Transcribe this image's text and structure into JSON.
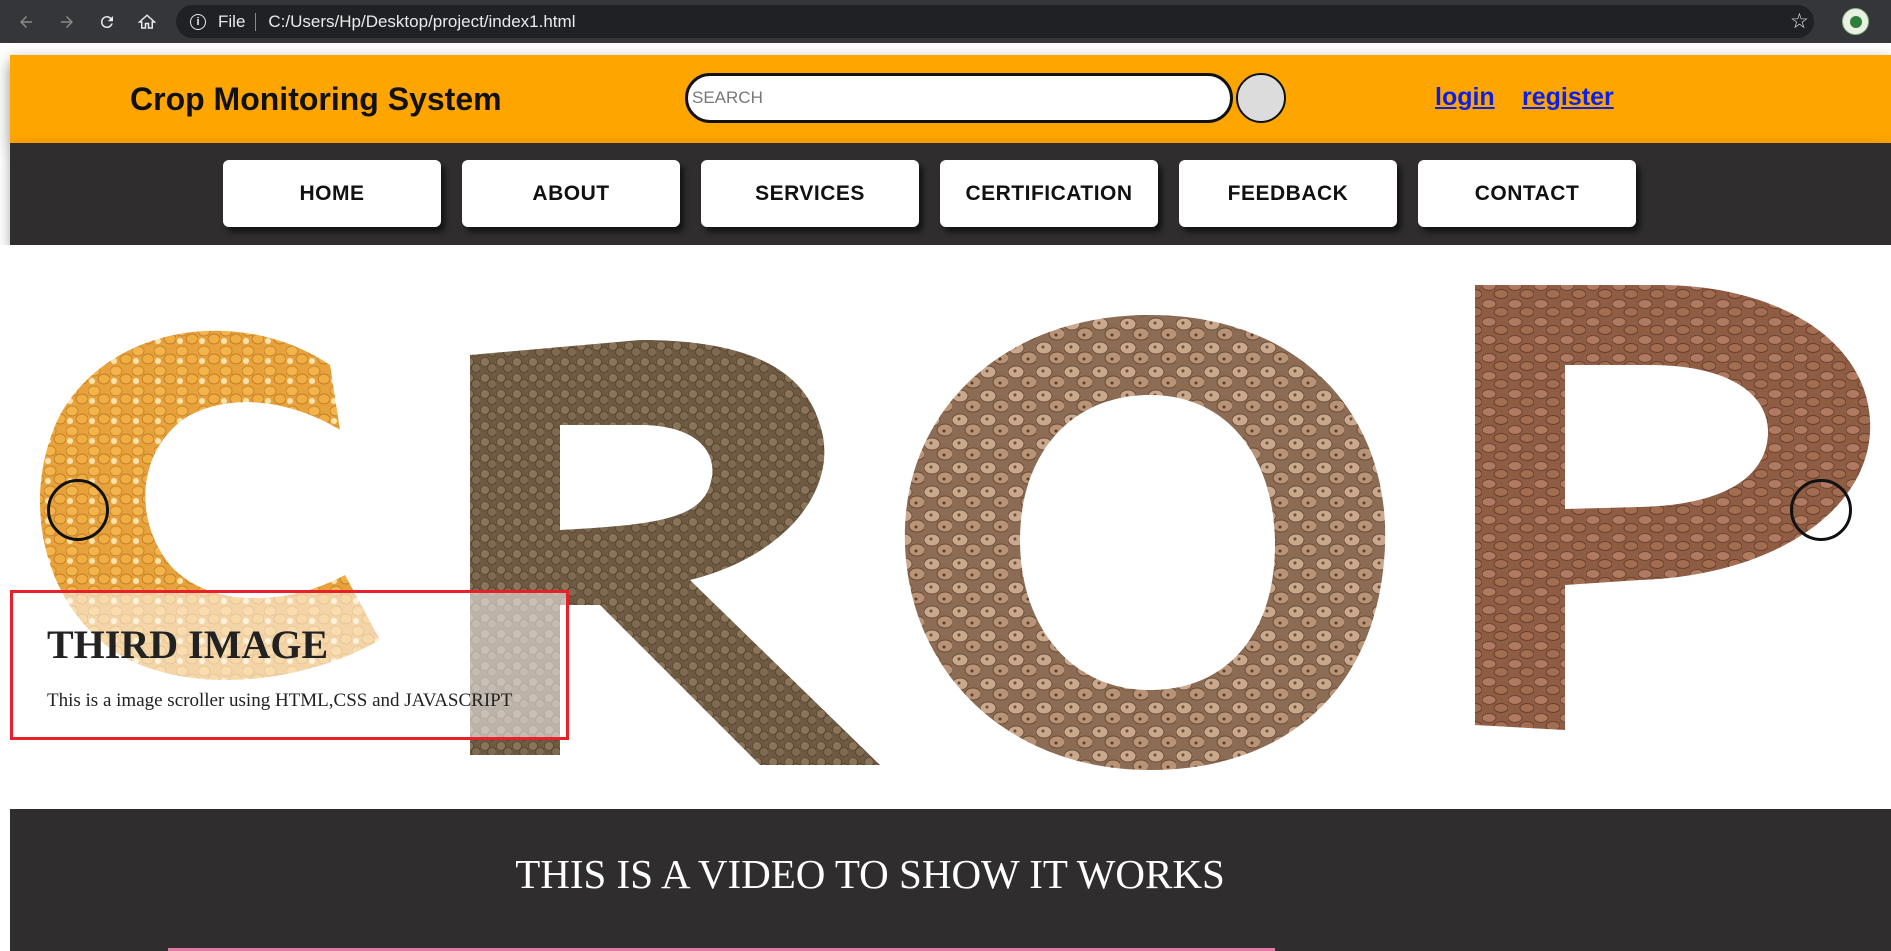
{
  "browser": {
    "scheme_label": "File",
    "url": "C:/Users/Hp/Desktop/project/index1.html",
    "icons": [
      "back-icon",
      "forward-icon",
      "reload-icon",
      "home-icon",
      "info-icon",
      "star-icon",
      "profile-avatar"
    ]
  },
  "header": {
    "title": "Crop Monitoring System",
    "search_placeholder": "SEARCH",
    "login_label": "login",
    "register_label": "register",
    "background_color": "#ffa500"
  },
  "nav": {
    "items": [
      {
        "label": "HOME"
      },
      {
        "label": "ABOUT"
      },
      {
        "label": "SERVICES"
      },
      {
        "label": "CERTIFICATION"
      },
      {
        "label": "FEEDBACK"
      },
      {
        "label": "CONTACT"
      }
    ],
    "background_color": "#2f2d2d"
  },
  "slider": {
    "image_text": "CROP",
    "caption_title": "THIRD IMAGE",
    "caption_text": "This is a image scroller using HTML,CSS and JAVASCRIPT",
    "caption_border_color": "#e8202a"
  },
  "video_section": {
    "title": "THIS IS A VIDEO TO SHOW IT WORKS"
  }
}
